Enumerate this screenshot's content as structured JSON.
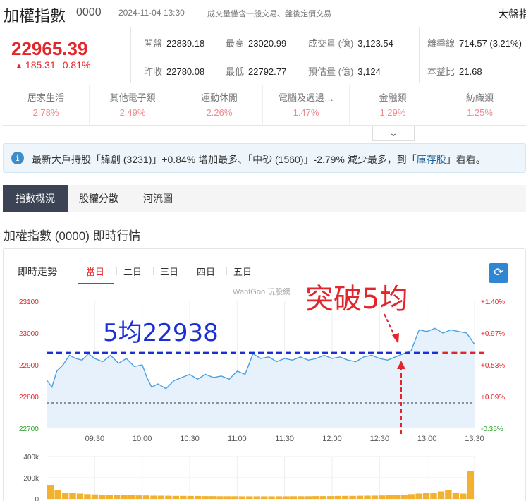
{
  "header": {
    "name": "加權指數",
    "code": "0000",
    "datetime": "2024-11-04 13:30",
    "note": "成交量僅含一般交易、盤後定價交易",
    "right_link": "大盤指"
  },
  "quote": {
    "price": "22965.39",
    "change": "185.31",
    "change_pct": "0.81%",
    "stats": [
      {
        "label": "開盤",
        "value": "22839.18"
      },
      {
        "label": "最高",
        "value": "23020.99"
      },
      {
        "label": "成交量 (億)",
        "value": "3,123.54"
      },
      {
        "label": "離季線",
        "value": "714.57 (3.21%)"
      },
      {
        "label": "昨收",
        "value": "22780.08"
      },
      {
        "label": "最低",
        "value": "22792.77"
      },
      {
        "label": "預估量 (億)",
        "value": "3,124"
      },
      {
        "label": "本益比",
        "value": "21.68"
      }
    ]
  },
  "sectors": [
    {
      "name": "居家生活",
      "pct": "2.78%"
    },
    {
      "name": "其他電子類",
      "pct": "2.49%"
    },
    {
      "name": "運動休閒",
      "pct": "2.26%"
    },
    {
      "name": "電腦及週邊…",
      "pct": "1.47%"
    },
    {
      "name": "金融類",
      "pct": "1.29%"
    },
    {
      "name": "紡織類",
      "pct": "1.25%"
    }
  ],
  "notice": {
    "icon": "i",
    "part1": "最新大戶持股「緯創 (3231)」+0.84% 增加最多、「中砂 (1560)」-2.79% 減少最多，到「",
    "link": "庫存股",
    "part2": "」看看。"
  },
  "tabs": [
    "指數概況",
    "股權分散",
    "河流圖"
  ],
  "section_title": "加權指數 (0000) 即時行情",
  "chart_panel": {
    "title": "即時走勢",
    "periods": [
      "當日",
      "二日",
      "三日",
      "四日",
      "五日"
    ],
    "watermark": "WantGoo 玩股網",
    "annotation_ma": "5均22938",
    "annotation_break": "突破5均"
  },
  "colors": {
    "up": "#e3262b",
    "down": "#2ca02c",
    "line": "#4a9fde",
    "fill": "#e6f1fb",
    "ma": "#1a2fd6",
    "breakline": "#e3262b",
    "volume": "#f2b230",
    "tab_active": "#3b4354"
  },
  "chart_data": {
    "type": "line",
    "x_ticks": [
      "09:30",
      "10:00",
      "10:30",
      "11:00",
      "11:30",
      "12:00",
      "12:30",
      "13:00",
      "13:30"
    ],
    "y_ticks_left": [
      "23100",
      "23000",
      "22900",
      "22800",
      "22700"
    ],
    "y_ticks_right": [
      "+1.40%",
      "+0.97%",
      "+0.53%",
      "+0.09%",
      "-0.35%"
    ],
    "ylim": [
      22700,
      23100
    ],
    "prev_close": 22780.08,
    "ma5": 22938,
    "x_minutes": [
      0,
      3,
      6,
      10,
      14,
      18,
      22,
      26,
      30,
      35,
      40,
      45,
      50,
      55,
      60,
      63,
      66,
      70,
      75,
      80,
      85,
      90,
      95,
      100,
      105,
      110,
      115,
      120,
      125,
      130,
      135,
      140,
      145,
      150,
      155,
      160,
      165,
      170,
      175,
      180,
      185,
      190,
      195,
      200,
      205,
      210,
      215,
      220,
      225,
      230,
      235,
      240,
      245,
      250,
      255,
      260,
      265,
      270
    ],
    "values": [
      22850,
      22830,
      22880,
      22900,
      22930,
      22920,
      22915,
      22935,
      22920,
      22910,
      22930,
      22905,
      22920,
      22895,
      22900,
      22860,
      22830,
      22840,
      22825,
      22850,
      22860,
      22870,
      22855,
      22870,
      22860,
      22865,
      22855,
      22880,
      22870,
      22935,
      22920,
      22925,
      22910,
      22920,
      22915,
      22925,
      22915,
      22920,
      22930,
      22920,
      22925,
      22915,
      22910,
      22925,
      22930,
      22920,
      22915,
      22925,
      22935,
      22945,
      23010,
      23005,
      23015,
      23000,
      23010,
      23005,
      23000,
      22965
    ],
    "volume_ylim": [
      0,
      400000
    ],
    "volume_ticks": [
      "400k",
      "200k",
      "0"
    ],
    "volume": [
      130000,
      80000,
      60000,
      55000,
      50000,
      45000,
      42000,
      40000,
      40000,
      38000,
      36000,
      34000,
      33000,
      32000,
      30000,
      30000,
      29000,
      28000,
      28000,
      27000,
      27000,
      26000,
      26000,
      25000,
      25000,
      25000,
      24000,
      24000,
      24000,
      24000,
      24000,
      24000,
      24000,
      25000,
      25000,
      25000,
      26000,
      26000,
      26000,
      27000,
      28000,
      28000,
      29000,
      30000,
      31000,
      32000,
      34000,
      36000,
      40000,
      45000,
      50000,
      55000,
      60000,
      70000,
      80000,
      60000,
      50000,
      260000
    ]
  }
}
